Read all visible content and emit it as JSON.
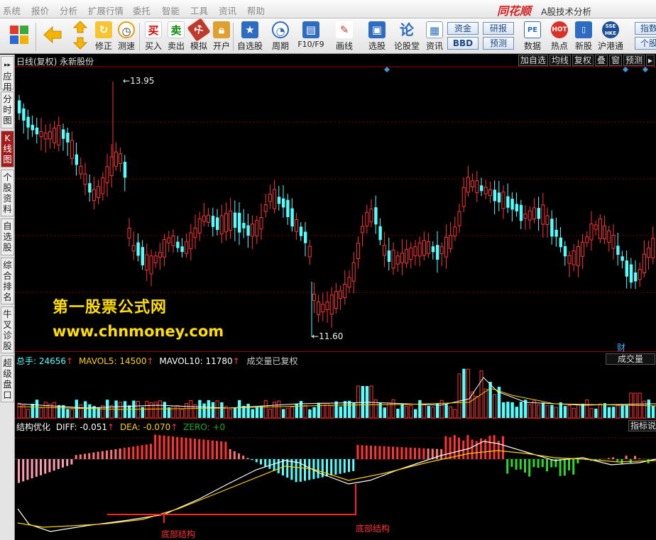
{
  "menubar": {
    "items": [
      "系统",
      "报价",
      "分析",
      "扩展行情",
      "委托",
      "智能",
      "工具",
      "资讯",
      "帮助"
    ],
    "brand": "同花顺",
    "app_title": "A股技术分析"
  },
  "toolbar": {
    "buttons": [
      "修正",
      "测速",
      "买入",
      "卖出",
      "模拟",
      "开户",
      "自选股",
      "周期",
      "F10/F9",
      "画线",
      "选股",
      "论股堂",
      "资讯",
      "数据",
      "热点",
      "新股",
      "沪港通",
      "指数"
    ],
    "mini_buttons": [
      "资金",
      "BBD",
      "研报",
      "预测",
      "个股"
    ]
  },
  "left_tabs": [
    "应用",
    "分时图",
    "K线图",
    "个股资料",
    "自选股",
    "综合排名",
    "牛叉诊股",
    "超级盘口"
  ],
  "kline": {
    "info": "日线(复权) 永新股份",
    "tools": [
      "加自选",
      "均线",
      "复权",
      "叠",
      "窗",
      "预测"
    ],
    "high_label": "13.95",
    "low_label": "11.60",
    "badge": "财"
  },
  "watermark": {
    "line1": "第一股票公式网",
    "line2": "www.chnmoney.com"
  },
  "volume": {
    "label_total": "总手: 24656",
    "label_mavol5": "MAVOL5: 14500",
    "label_mavol10": "MAVOL10: 11780",
    "note": "成交量已复权",
    "button": "成交量"
  },
  "macd": {
    "name": "结构优化",
    "diff": "DIFF: -0.051",
    "dea": "DEA: -0.070",
    "zero": "ZERO: +0",
    "button": "指标说明",
    "annotation_1": "底部结构",
    "annotation_2": "底部结构"
  },
  "colors": {
    "up": "#ff3333",
    "down": "#54ffff",
    "grid": "#7a0000",
    "label_yellow": "#ffd200",
    "white": "#ffffff"
  }
}
